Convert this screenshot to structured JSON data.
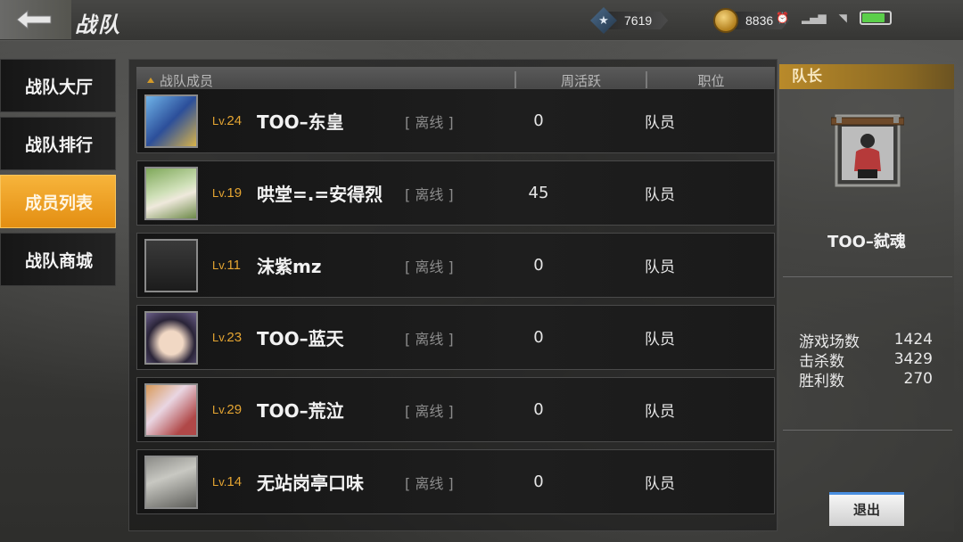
{
  "header": {
    "title": "战队",
    "rank_value": "7619",
    "gold_value": "8836",
    "battery_level": 0.85
  },
  "nav": {
    "items": [
      {
        "label": "战队大厅",
        "active": false
      },
      {
        "label": "战队排行",
        "active": false
      },
      {
        "label": "成员列表",
        "active": true
      },
      {
        "label": "战队商城",
        "active": false
      }
    ]
  },
  "table": {
    "headers": {
      "members": "战队成员",
      "activity": "周活跃",
      "role": "职位"
    },
    "rows": [
      {
        "lv_prefix": "Lv.",
        "lv": "24",
        "name": "TOO–东皇",
        "status": "[ 离线 ]",
        "activity": "0",
        "role": "队员",
        "avatar": "anime-blue"
      },
      {
        "lv_prefix": "Lv.",
        "lv": "19",
        "name": "哄堂=.=安得烈",
        "status": "[ 离线 ]",
        "activity": "45",
        "role": "队员",
        "avatar": "photo-green"
      },
      {
        "lv_prefix": "Lv.",
        "lv": "11",
        "name": "沫紫mz",
        "status": "[ 离线 ]",
        "activity": "0",
        "role": "队员",
        "avatar": "photo-gray"
      },
      {
        "lv_prefix": "Lv.",
        "lv": "23",
        "name": "TOO–蓝天",
        "status": "[ 离线 ]",
        "activity": "0",
        "role": "队员",
        "avatar": "anime-smile"
      },
      {
        "lv_prefix": "Lv.",
        "lv": "29",
        "name": "TOO–荒泣",
        "status": "[ 离线 ]",
        "activity": "0",
        "role": "队员",
        "avatar": "anime-frame"
      },
      {
        "lv_prefix": "Lv.",
        "lv": "14",
        "name": "无站岗亭口味",
        "status": "[ 离线 ]",
        "activity": "0",
        "role": "队员",
        "avatar": "photo-machine"
      }
    ]
  },
  "captain": {
    "header": "队长",
    "name": "TOO–弑魂",
    "stats": [
      {
        "label": "游戏场数",
        "value": "1424"
      },
      {
        "label": "击杀数",
        "value": "3429"
      },
      {
        "label": "胜利数",
        "value": "270"
      }
    ],
    "quit_label": "退出"
  }
}
